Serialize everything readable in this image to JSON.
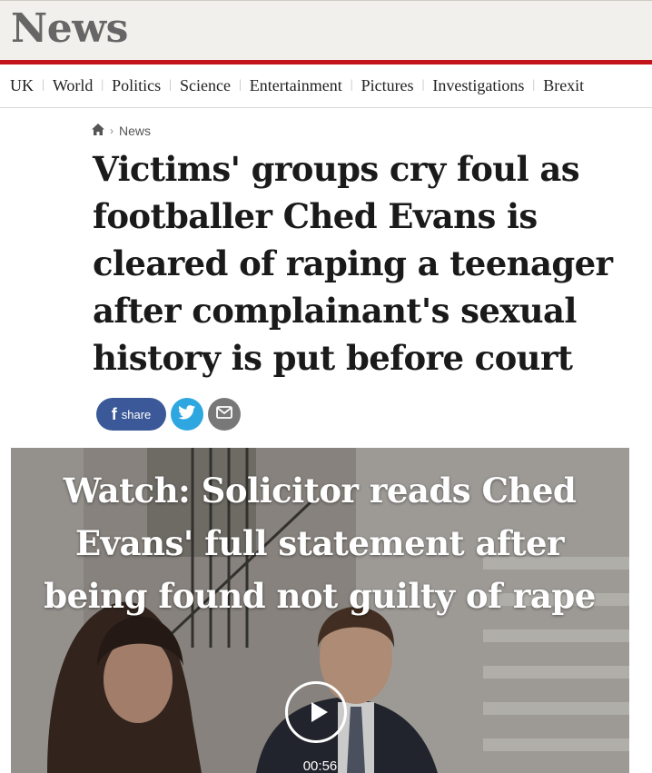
{
  "masthead": {
    "brand": "News"
  },
  "nav": {
    "items": [
      "UK",
      "World",
      "Politics",
      "Science",
      "Entertainment",
      "Pictures",
      "Investigations",
      "Brexit"
    ]
  },
  "breadcrumb": {
    "home_icon": "home-icon",
    "section": "News"
  },
  "article": {
    "headline": "Victims' groups cry foul as footballer Ched Evans is cleared of raping a teenager after complainant's sexual history is put before court"
  },
  "share": {
    "facebook_label": "share",
    "icons": [
      "facebook-icon",
      "twitter-icon",
      "email-icon"
    ]
  },
  "video": {
    "title": "Watch: Solicitor reads Ched Evans' full statement after being found not guilty of rape",
    "duration": "00:56"
  },
  "colors": {
    "brand_red": "#c3131b",
    "facebook": "#3b5998",
    "twitter": "#2ea7e0",
    "email": "#787878"
  }
}
